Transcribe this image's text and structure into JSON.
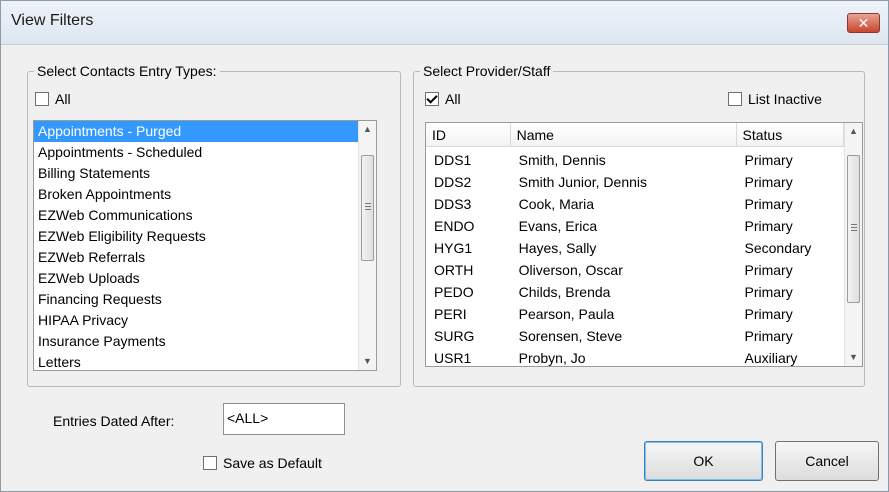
{
  "window": {
    "title": "View Filters",
    "close_symbol": "✕"
  },
  "contacts": {
    "legend": "Select Contacts Entry Types:",
    "all_label": "All",
    "all_checked": false,
    "items": [
      {
        "label": "Appointments - Purged",
        "selected": true
      },
      {
        "label": "Appointments - Scheduled",
        "selected": false
      },
      {
        "label": "Billing Statements",
        "selected": false
      },
      {
        "label": "Broken Appointments",
        "selected": false
      },
      {
        "label": "EZWeb Communications",
        "selected": false
      },
      {
        "label": "EZWeb Eligibility Requests",
        "selected": false
      },
      {
        "label": "EZWeb Referrals",
        "selected": false
      },
      {
        "label": "EZWeb Uploads",
        "selected": false
      },
      {
        "label": "Financing Requests",
        "selected": false
      },
      {
        "label": "HIPAA Privacy",
        "selected": false
      },
      {
        "label": "Insurance Payments",
        "selected": false
      },
      {
        "label": "Letters",
        "selected": false
      }
    ]
  },
  "providers": {
    "legend": "Select Provider/Staff",
    "all_label": "All",
    "all_checked": true,
    "list_inactive_label": "List Inactive",
    "list_inactive_checked": false,
    "columns": [
      "ID",
      "Name",
      "Status"
    ],
    "rows": [
      [
        "DDS1",
        "Smith, Dennis",
        "Primary"
      ],
      [
        "DDS2",
        "Smith Junior, Dennis",
        "Primary"
      ],
      [
        "DDS3",
        "Cook, Maria",
        "Primary"
      ],
      [
        "ENDO",
        "Evans, Erica",
        "Primary"
      ],
      [
        "HYG1",
        "Hayes, Sally",
        "Secondary"
      ],
      [
        "ORTH",
        "Oliverson, Oscar",
        "Primary"
      ],
      [
        "PEDO",
        "Childs, Brenda",
        "Primary"
      ],
      [
        "PERI",
        "Pearson, Paula",
        "Primary"
      ],
      [
        "SURG",
        "Sorensen, Steve",
        "Primary"
      ],
      [
        "USR1",
        "Probyn, Jo",
        "Auxiliary"
      ]
    ]
  },
  "entries_dated_after": {
    "label": "Entries Dated After:",
    "value": "<ALL>"
  },
  "save_default": {
    "label": "Save as Default",
    "checked": false
  },
  "buttons": {
    "ok": "OK",
    "cancel": "Cancel"
  },
  "icons": {
    "scroll_up": "▲",
    "scroll_down": "▼"
  }
}
